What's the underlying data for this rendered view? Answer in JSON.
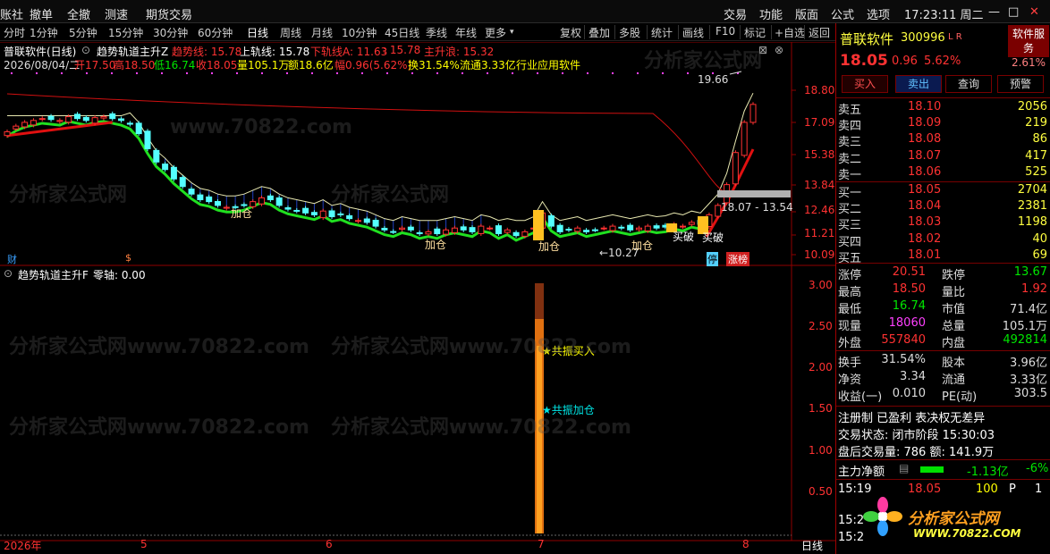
{
  "topbar": {
    "left_items": [
      "账社",
      "撤单",
      "全撤",
      "测速",
      "期货交易"
    ],
    "right_items": [
      "交易",
      "功能",
      "版面",
      "公式",
      "选项"
    ],
    "clock": "17:23:11 周二",
    "min": "—",
    "max": "□",
    "close": "✕"
  },
  "periods": [
    "分时",
    "1分钟",
    "5分钟",
    "15分钟",
    "30分钟",
    "60分钟",
    "日线",
    "周线",
    "月线",
    "10分钟",
    "45日线",
    "季线",
    "年线",
    "更多"
  ],
  "more_arrow": "▾",
  "tools": [
    "复权",
    "叠加",
    "多股",
    "统计",
    "画线",
    "F10",
    "标记",
    "+自选",
    "返回"
  ],
  "main": {
    "title": "普联软件(日线)",
    "indicator": "趋势轨道主升Z",
    "trend": "趋势线: 15.78",
    "upper": "上轨线: 15.78",
    "lower": "下轨线A: 11.63",
    "lower2": ": 15.78",
    "main_up": "主升浪: 15.32",
    "info_date": "2026/08/04/二",
    "info_open": "开17.50",
    "info_high": "高18.50",
    "info_low": "低16.74",
    "info_close": "收18.05",
    "info_vol": "量105.1万",
    "info_amt": "额18.6亿",
    "info_chg": "幅0.96(5.62%)",
    "info_turn": "换31.54%",
    "info_float": "流通3.33亿",
    "info_ind": "行业应用软件",
    "price_axis": [
      "18.80",
      "17.09",
      "15.38",
      "13.84",
      "12.46",
      "11.21",
      "10.09"
    ],
    "max_label": "19.66",
    "min_label": "←10.27",
    "range_label": "18.07 - 13.54",
    "signals": [
      "加仓",
      "加仓",
      "加仓",
      "加仓",
      "买破",
      "买破"
    ],
    "bottom_tags": [
      "财",
      "$",
      "停",
      "涨榜"
    ]
  },
  "sub": {
    "title": "趋势轨道主升F",
    "zero": "零轴: 0.00",
    "axis": [
      "3.00",
      "2.50",
      "2.00",
      "1.50",
      "1.00",
      "0.50"
    ],
    "buy": "★共振买入",
    "add": "★共振加仓"
  },
  "timeaxis": {
    "labels": [
      "2026年",
      "5",
      "6",
      "7",
      "8"
    ],
    "mode": "日线"
  },
  "right": {
    "name": "普联软件",
    "code": "300996",
    "lr": "L R",
    "service": "软件服务",
    "price": "18.05",
    "chg": "0.96",
    "pct": "5.62%",
    "pct_box": "2.61%",
    "buttons": [
      "买入",
      "卖出",
      "查询",
      "预警"
    ],
    "asks": [
      {
        "n": "卖五",
        "p": "18.10",
        "v": "2056"
      },
      {
        "n": "卖四",
        "p": "18.09",
        "v": "219"
      },
      {
        "n": "卖三",
        "p": "18.08",
        "v": "86"
      },
      {
        "n": "卖二",
        "p": "18.07",
        "v": "417"
      },
      {
        "n": "卖一",
        "p": "18.06",
        "v": "525"
      }
    ],
    "bids": [
      {
        "n": "买一",
        "p": "18.05",
        "v": "2704"
      },
      {
        "n": "买二",
        "p": "18.04",
        "v": "2381"
      },
      {
        "n": "买三",
        "p": "18.03",
        "v": "1198"
      },
      {
        "n": "买四",
        "p": "18.02",
        "v": "40"
      },
      {
        "n": "买五",
        "p": "18.01",
        "v": "69"
      }
    ],
    "stats": [
      {
        "a": "涨停",
        "b": "20.51",
        "c": "跌停",
        "d": "13.67"
      },
      {
        "a": "最高",
        "b": "18.50",
        "c": "量比",
        "d": "1.92"
      },
      {
        "a": "最低",
        "b": "16.74",
        "c": "市值",
        "d": "71.4亿"
      },
      {
        "a": "现量",
        "b": "18060",
        "c": "总量",
        "d": "105.1万"
      },
      {
        "a": "外盘",
        "b": "557840",
        "c": "内盘",
        "d": "492814"
      }
    ],
    "stats2": [
      {
        "a": "换手",
        "b": "31.54%",
        "c": "股本",
        "d": "3.96亿"
      },
      {
        "a": "净资",
        "b": "3.34",
        "c": "流通",
        "d": "3.33亿"
      },
      {
        "a": "收益(一)",
        "b": "0.010",
        "c": "PE(动)",
        "d": "303.5"
      }
    ],
    "reg": "注册制 已盈利 表决权无差异",
    "status": "交易状态: 闭市阶段 15:30:03",
    "after": "盘后交易量: 786 额: 141.9万",
    "flow_label": "主力净额",
    "flow_val": "-1.13亿",
    "flow_pct": "-6%",
    "tick_time": "15:19",
    "tick_price": "18.05",
    "tick_vol": "100",
    "tick_flag": "P",
    "tick_n": "1",
    "tick_times2": [
      "15:2",
      "15:2"
    ],
    "logo_text": "分析家公式网",
    "logo_url": "WWW.70822.COM"
  },
  "watermark": "分析家公式网www.70822.com",
  "colors": {
    "up": "#ff3232",
    "down": "#54ffff",
    "bg": "#000000",
    "border": "#a00000"
  }
}
